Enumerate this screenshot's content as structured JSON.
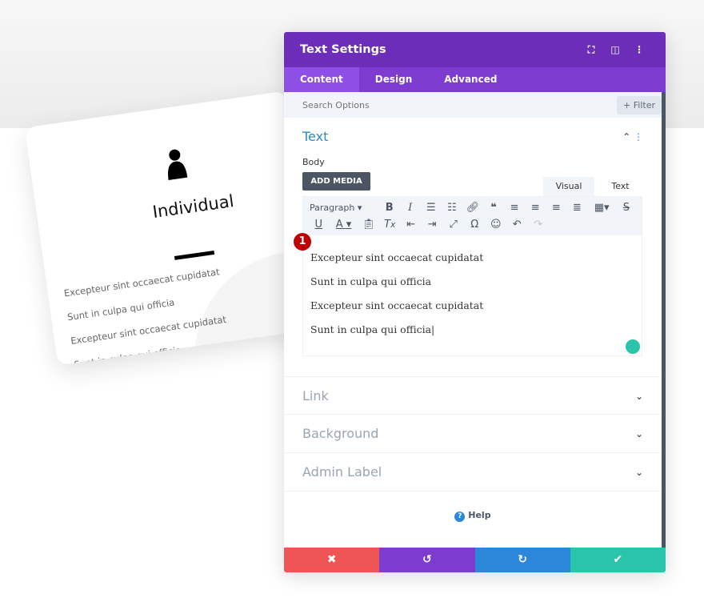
{
  "card": {
    "title": "Individual",
    "lines": [
      "Excepteur sint occaecat cupidatat",
      "Sunt in culpa qui officia",
      "Excepteur sint occaecat cupidatat",
      "Sunt in culpa qui officia"
    ]
  },
  "panel": {
    "title": "Text Settings",
    "tabs": [
      "Content",
      "Design",
      "Advanced"
    ],
    "search_placeholder": "Search Options",
    "filter_label": "+ Filter",
    "text_section": "Text",
    "body_label": "Body",
    "add_media": "ADD MEDIA",
    "view_tabs": [
      "Visual",
      "Text"
    ],
    "format_select": "Paragraph",
    "editor_lines": [
      "Excepteur sint occaecat cupidatat",
      "Sunt in culpa qui officia",
      "Excepteur sint occaecat cupidatat",
      "Sunt in culpa qui officia"
    ],
    "badge": "1",
    "sections": [
      "Link",
      "Background",
      "Admin Label"
    ],
    "help": "Help"
  },
  "colors": {
    "header": "#6c2eb9",
    "tabs": "#7e3bd0",
    "cancel": "#ef5555",
    "undo": "#7e3bd0",
    "redo": "#2b87da",
    "save": "#29c4a9"
  }
}
